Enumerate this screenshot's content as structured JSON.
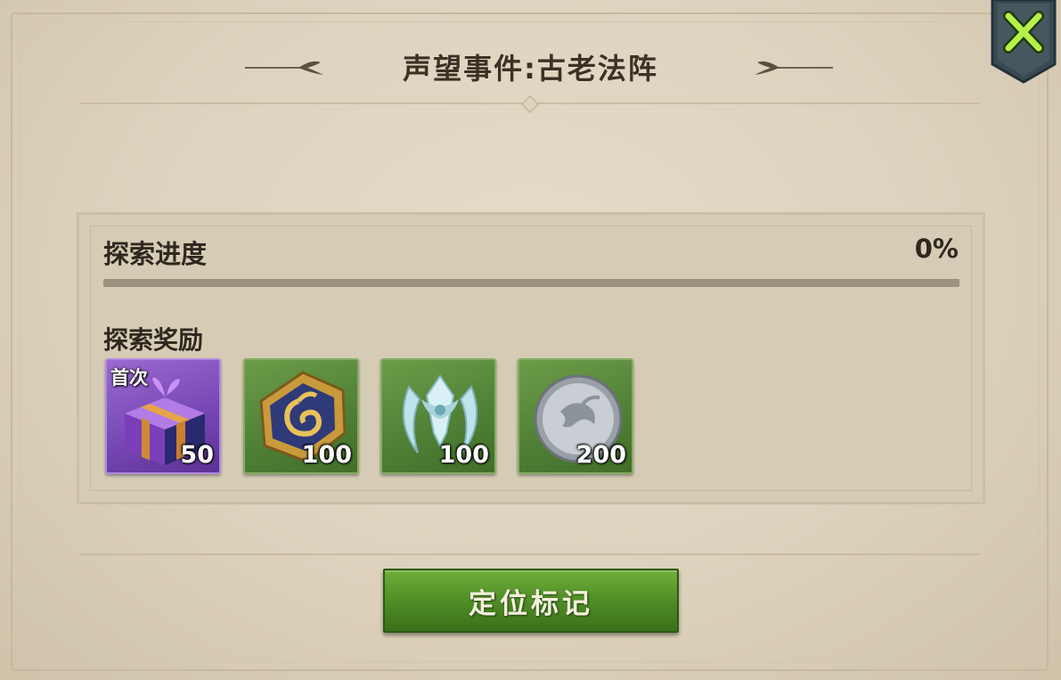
{
  "dialog": {
    "title": "声望事件:古老法阵",
    "close_icon": "close-x-icon"
  },
  "progress": {
    "label": "探索进度",
    "value_text": "0%",
    "fraction": 0.0
  },
  "rewards": {
    "label": "探索奖励",
    "items": [
      {
        "icon": "purple-gift-box-icon",
        "tag": "首次",
        "count": "50",
        "rarity_color": "#7546b3"
      },
      {
        "icon": "gold-hexagon-emblem-icon",
        "tag": "",
        "count": "100",
        "rarity_color": "#4f7f35"
      },
      {
        "icon": "silver-crest-emblem-icon",
        "tag": "",
        "count": "100",
        "rarity_color": "#4f7f35"
      },
      {
        "icon": "silver-coin-icon",
        "tag": "",
        "count": "200",
        "rarity_color": "#4f7f35"
      }
    ]
  },
  "actions": {
    "locate_label": "定位标记"
  },
  "colors": {
    "parchment": "#ddd2bd",
    "accent_green": "#4d8b25",
    "text_dark": "#2f2820"
  }
}
